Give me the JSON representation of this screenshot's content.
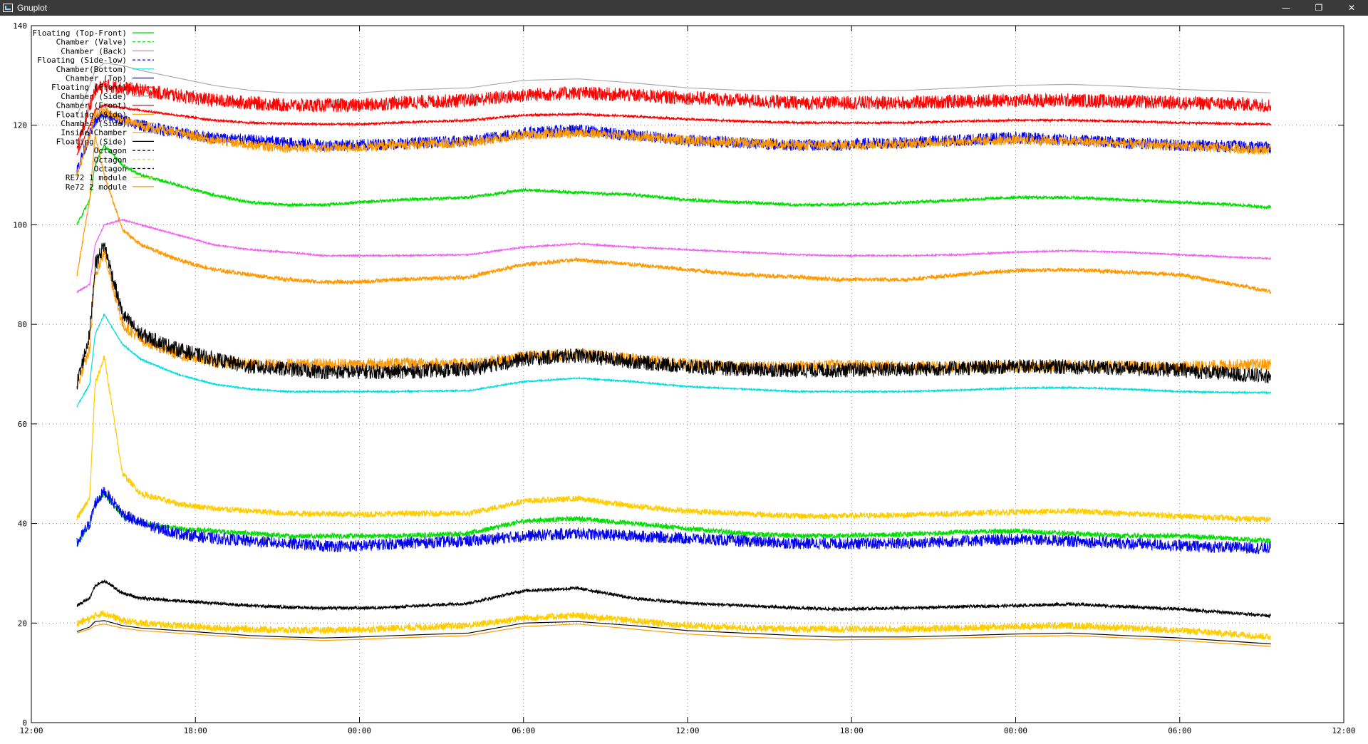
{
  "window": {
    "title": "Gnuplot",
    "minimize_glyph": "—",
    "restore_glyph": "❐",
    "close_glyph": "✕"
  },
  "chart_data": {
    "type": "line",
    "title": "",
    "xlabel": "",
    "ylabel": "",
    "ylim": [
      0,
      140
    ],
    "yticks": [
      0,
      20,
      40,
      60,
      80,
      100,
      120,
      140
    ],
    "xlim_hours": [
      0,
      72
    ],
    "xtick_labels": [
      "12:00",
      "18:00",
      "00:00",
      "06:00",
      "12:00",
      "18:00",
      "00:00",
      "06:00",
      "12:00"
    ],
    "grid": true,
    "legend_position": "top-left",
    "x_hours": [
      2.5,
      3.2,
      3.5,
      4.0,
      5.0,
      6.0,
      8.0,
      10.0,
      12.0,
      14.0,
      16.0,
      18.0,
      20.0,
      24.0,
      27.0,
      30.0,
      33.0,
      36.0,
      39.0,
      42.0,
      44.0,
      48.0,
      51.0,
      54.0,
      57.0,
      60.0,
      63.0,
      66.0,
      68.0
    ],
    "series": [
      {
        "name": "Floating (Top-Front)",
        "color": "#00dd00",
        "dashed": false,
        "noise": 0.5,
        "values": [
          35.5,
          40.0,
          44.0,
          46.0,
          41.5,
          40.0,
          39.0,
          38.5,
          38.0,
          37.5,
          37.5,
          37.5,
          37.5,
          38.0,
          40.5,
          41.0,
          40.0,
          39.0,
          38.0,
          37.5,
          37.5,
          37.8,
          38.3,
          38.5,
          38.0,
          37.5,
          37.5,
          37.0,
          36.5
        ]
      },
      {
        "name": "Chamber (Valve)",
        "color": "#00dd00",
        "dashed": true,
        "noise": 0.3,
        "values": [
          100.0,
          105.0,
          112.0,
          116.0,
          112.0,
          110.0,
          108.0,
          106.0,
          104.5,
          104.0,
          104.0,
          104.5,
          105.0,
          105.5,
          107.0,
          106.5,
          106.0,
          105.0,
          104.5,
          104.0,
          104.0,
          104.5,
          105.0,
          105.5,
          105.5,
          105.0,
          104.5,
          104.0,
          103.5
        ]
      },
      {
        "name": "Chamber (Back)",
        "color": "#ee66ee",
        "dashed": false,
        "noise": 0.15,
        "values": [
          86.5,
          88.0,
          96.0,
          100.0,
          101.0,
          100.0,
          98.0,
          96.0,
          95.0,
          94.5,
          93.8,
          93.8,
          93.8,
          94.0,
          95.5,
          96.2,
          95.5,
          95.0,
          94.5,
          94.0,
          93.8,
          93.8,
          94.0,
          94.5,
          94.8,
          94.5,
          94.0,
          93.5,
          93.2
        ]
      },
      {
        "name": "Floating (Side-low)",
        "color": "#0000ee",
        "dashed": true,
        "noise": 1.2,
        "values": [
          36.0,
          40.0,
          44.0,
          46.5,
          42.0,
          40.0,
          38.0,
          37.0,
          36.5,
          36.0,
          35.5,
          35.5,
          36.0,
          36.5,
          37.5,
          38.0,
          37.5,
          37.0,
          36.5,
          36.0,
          36.0,
          36.0,
          36.5,
          36.8,
          36.5,
          36.0,
          35.5,
          35.2,
          35.0
        ]
      },
      {
        "name": "Chamber(Bottom)",
        "color": "#00dddd",
        "dashed": false,
        "noise": 0.15,
        "values": [
          63.5,
          68.0,
          78.0,
          82.0,
          76.0,
          73.0,
          70.0,
          68.0,
          67.0,
          66.5,
          66.5,
          66.5,
          66.5,
          66.7,
          68.5,
          69.2,
          68.5,
          67.5,
          67.0,
          66.5,
          66.5,
          66.5,
          66.8,
          67.2,
          67.3,
          67.0,
          66.5,
          66.3,
          66.3
        ]
      },
      {
        "name": "Chamber (Top)",
        "color": "#0000ee",
        "dashed": false,
        "noise": 1.2,
        "values": [
          111.0,
          118.0,
          121.0,
          122.0,
          121.0,
          120.0,
          118.5,
          117.5,
          117.0,
          116.5,
          116.0,
          116.0,
          116.3,
          116.8,
          118.5,
          119.0,
          118.0,
          117.0,
          116.5,
          116.0,
          116.0,
          116.5,
          117.0,
          117.5,
          117.0,
          116.5,
          116.0,
          115.8,
          115.5
        ]
      },
      {
        "name": "Floating (Front)",
        "color": "#ff0000",
        "dashed": false,
        "noise": 1.4,
        "values": [
          115.0,
          124.0,
          127.0,
          128.0,
          127.5,
          127.0,
          126.0,
          125.0,
          124.5,
          124.0,
          124.0,
          124.0,
          124.5,
          125.0,
          126.0,
          126.5,
          126.0,
          125.5,
          125.0,
          124.5,
          124.5,
          124.5,
          124.8,
          125.0,
          125.0,
          124.8,
          124.5,
          124.3,
          124.0
        ]
      },
      {
        "name": "Chamber (Side)",
        "color": "#aaaaaa",
        "dashed": false,
        "noise": 0.0,
        "values": [
          122.0,
          128.0,
          131.0,
          132.5,
          132.0,
          131.0,
          129.5,
          128.0,
          127.0,
          126.5,
          126.5,
          126.5,
          127.0,
          127.5,
          129.0,
          129.3,
          128.5,
          127.5,
          127.0,
          126.8,
          126.8,
          127.0,
          127.5,
          128.0,
          128.2,
          127.8,
          127.2,
          126.8,
          126.5
        ]
      },
      {
        "name": "Chamber (Front)",
        "color": "#ff0000",
        "dashed": false,
        "noise": 0.2,
        "values": [
          114.0,
          120.0,
          123.0,
          124.0,
          123.5,
          123.0,
          122.0,
          121.0,
          120.5,
          120.3,
          120.2,
          120.2,
          120.5,
          121.0,
          122.0,
          122.2,
          121.8,
          121.2,
          120.8,
          120.5,
          120.5,
          120.5,
          120.8,
          121.0,
          121.0,
          120.8,
          120.5,
          120.3,
          120.2
        ]
      },
      {
        "name": "Floating (Side)",
        "color": "#ff9900",
        "dashed": false,
        "noise": 1.2,
        "values": [
          67.5,
          75.0,
          90.0,
          94.5,
          80.0,
          77.0,
          74.0,
          72.5,
          72.0,
          72.0,
          72.0,
          72.0,
          72.2,
          72.0,
          73.5,
          74.0,
          73.0,
          72.0,
          71.5,
          71.5,
          71.8,
          71.5,
          71.5,
          71.5,
          71.7,
          71.5,
          71.5,
          71.8,
          72.0
        ]
      },
      {
        "name": "Chamber (Side)",
        "color": "#ff9900",
        "dashed": false,
        "noise": 1.0,
        "values": [
          110.0,
          118.0,
          122.0,
          123.0,
          121.0,
          120.0,
          118.5,
          117.0,
          116.0,
          115.5,
          115.5,
          115.5,
          116.0,
          116.5,
          118.0,
          118.5,
          117.8,
          117.0,
          116.5,
          116.0,
          116.0,
          116.3,
          116.8,
          117.0,
          116.8,
          116.3,
          115.8,
          115.3,
          115.0
        ]
      },
      {
        "name": "Inside Chamber",
        "color": "#ff9900",
        "dashed": false,
        "noise": 0.4,
        "values": [
          90.0,
          105.0,
          118.0,
          110.0,
          99.0,
          96.0,
          93.0,
          91.0,
          90.0,
          89.0,
          88.5,
          88.5,
          89.0,
          89.5,
          92.0,
          93.0,
          92.0,
          91.0,
          90.0,
          89.5,
          89.0,
          89.0,
          90.0,
          90.8,
          91.0,
          90.5,
          90.0,
          88.0,
          86.5
        ]
      },
      {
        "name": "Floating (Side)",
        "color": "#000000",
        "dashed": false,
        "noise": 1.5,
        "values": [
          68.0,
          78.0,
          92.0,
          96.0,
          82.0,
          78.0,
          75.0,
          73.0,
          71.5,
          71.0,
          70.5,
          70.5,
          70.5,
          71.0,
          73.0,
          73.8,
          72.5,
          71.5,
          71.0,
          70.8,
          70.8,
          71.0,
          71.2,
          71.5,
          71.5,
          71.2,
          70.8,
          70.0,
          69.5
        ]
      },
      {
        "name": "Octagon",
        "color": "#000000",
        "dashed": true,
        "noise": 0.3,
        "values": [
          23.5,
          25.0,
          27.5,
          28.5,
          26.0,
          25.0,
          24.5,
          24.0,
          23.5,
          23.2,
          23.0,
          23.0,
          23.2,
          24.0,
          26.5,
          27.0,
          25.0,
          24.0,
          23.5,
          23.0,
          22.8,
          23.0,
          23.3,
          23.5,
          23.8,
          23.3,
          22.8,
          22.0,
          21.5
        ]
      },
      {
        "name": "Octagon",
        "color": "#ffcc00",
        "dashed": true,
        "noise": 0.6,
        "values": [
          41.0,
          45.0,
          68.0,
          73.5,
          50.0,
          46.0,
          44.0,
          43.0,
          42.5,
          42.0,
          42.0,
          41.8,
          42.0,
          42.0,
          44.5,
          45.0,
          43.5,
          42.5,
          42.0,
          41.5,
          41.5,
          41.7,
          42.0,
          42.3,
          42.5,
          42.0,
          41.5,
          41.0,
          40.8
        ]
      },
      {
        "name": "Octagon",
        "color": "#000000",
        "dashed": true,
        "noise": 0.0,
        "values": [
          18.3,
          19.2,
          20.3,
          20.5,
          19.5,
          19.0,
          18.5,
          18.0,
          17.5,
          17.2,
          17.0,
          17.2,
          17.5,
          18.0,
          20.0,
          20.3,
          19.5,
          18.5,
          18.0,
          17.5,
          17.2,
          17.2,
          17.5,
          17.8,
          18.0,
          17.5,
          17.0,
          16.3,
          15.8
        ]
      },
      {
        "name": "RE72 1 module",
        "color": "#ffcc00",
        "dashed": false,
        "noise": 0.7,
        "values": [
          20.0,
          20.8,
          21.5,
          22.0,
          20.5,
          20.0,
          19.5,
          19.0,
          18.8,
          18.6,
          18.5,
          18.7,
          19.0,
          19.5,
          21.0,
          21.5,
          20.5,
          19.5,
          19.0,
          18.8,
          18.8,
          18.8,
          19.0,
          19.3,
          19.5,
          19.0,
          18.5,
          17.8,
          17.2
        ]
      },
      {
        "name": "Re72 2 module",
        "color": "#ff9900",
        "dashed": false,
        "noise": 0.0,
        "values": [
          18.0,
          18.8,
          19.5,
          19.8,
          19.0,
          18.5,
          18.0,
          17.5,
          17.0,
          16.8,
          16.5,
          16.7,
          17.0,
          17.5,
          19.3,
          19.8,
          18.8,
          17.8,
          17.2,
          16.8,
          16.6,
          16.8,
          17.0,
          17.3,
          17.5,
          17.0,
          16.5,
          15.8,
          15.3
        ]
      }
    ]
  }
}
